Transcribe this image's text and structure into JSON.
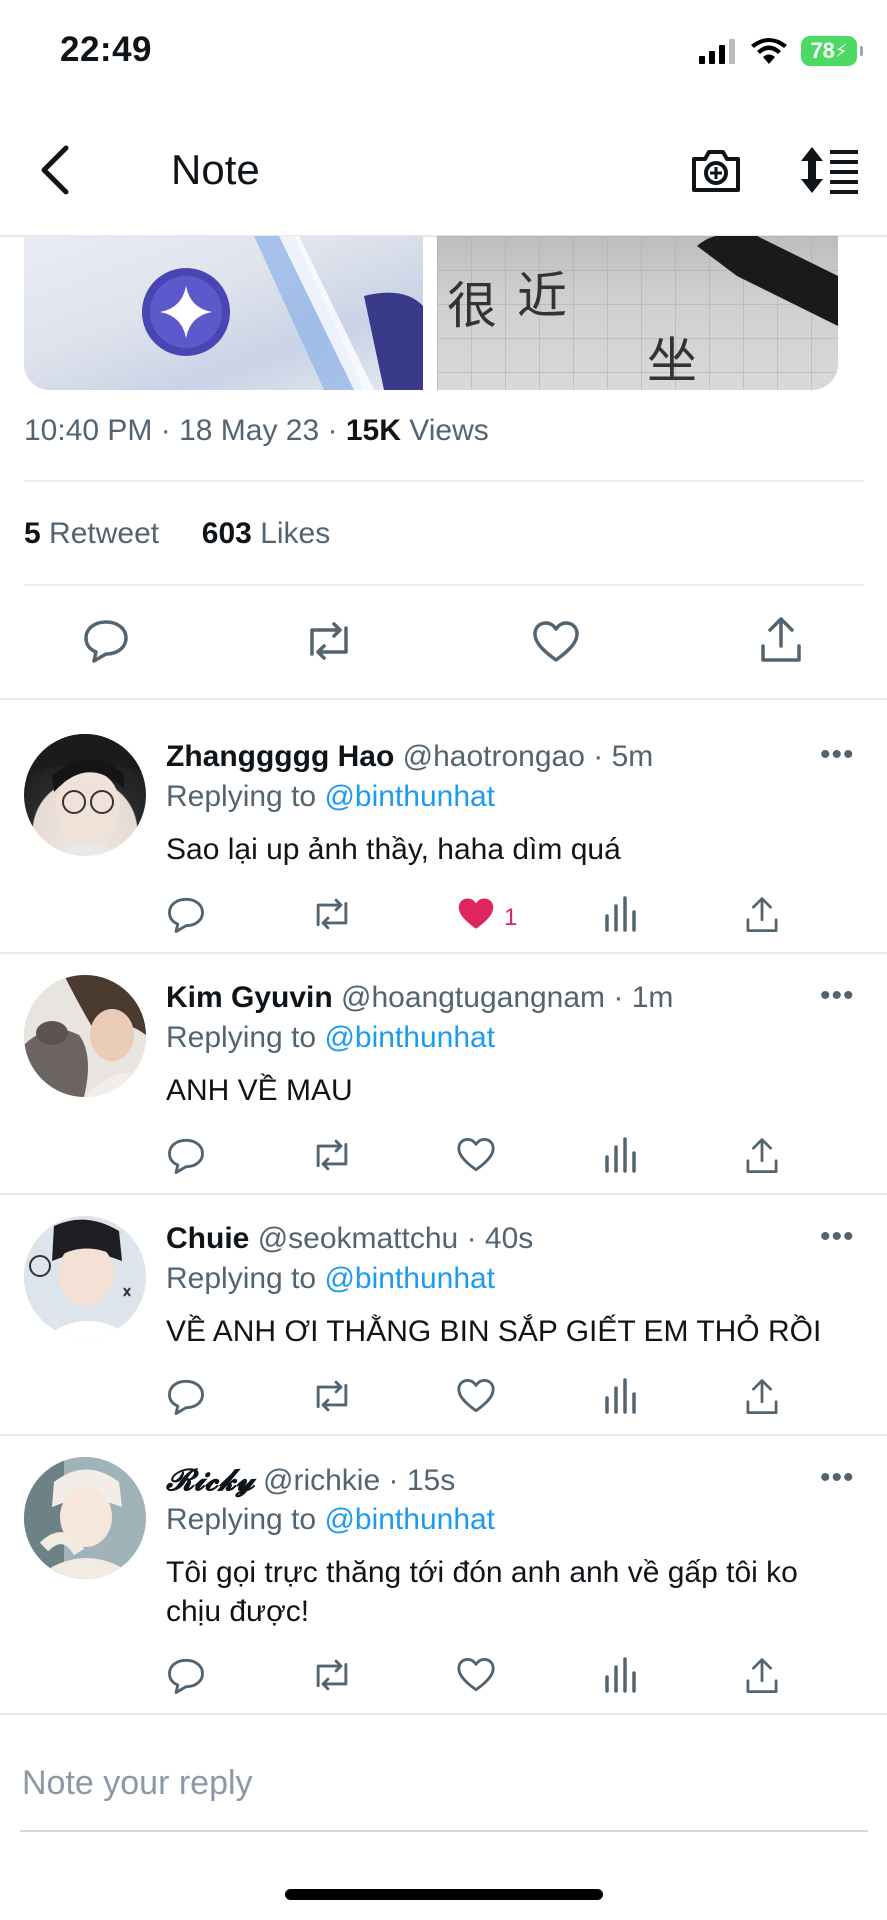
{
  "status_bar": {
    "time": "22:49",
    "battery": "78"
  },
  "nav": {
    "title": "Note",
    "back_icon": "chevron-left-icon",
    "camera_icon": "camera-plus-icon",
    "sort_icon": "sort-list-icon"
  },
  "tweet": {
    "time": "10:40 PM",
    "date": "18 May 23",
    "views_count": "15K",
    "views_label": "Views",
    "retweet_count": "5",
    "retweet_label": "Retweet",
    "likes_count": "603",
    "likes_label": "Likes"
  },
  "replies": [
    {
      "name": "Zhanggggg Hao",
      "handle": "@haotrongao",
      "time": "5m",
      "replying_label": "Replying to",
      "mention": "@binthunhat",
      "text": "Sao lại up ảnh thầy, haha dìm quá",
      "liked": true,
      "like_count": "1"
    },
    {
      "name": "Kim Gyuvin",
      "handle": "@hoangtugangnam",
      "time": "1m",
      "replying_label": "Replying to",
      "mention": "@binthunhat",
      "text": "ANH VỀ MAU",
      "liked": false,
      "like_count": ""
    },
    {
      "name": "Chuie",
      "handle": "@seokmattchu",
      "time": "40s",
      "replying_label": "Replying to",
      "mention": "@binthunhat",
      "text": "VỀ ANH ƠI THẰNG BIN SẮP GIẾT EM THỎ RỒI",
      "liked": false,
      "like_count": ""
    },
    {
      "name": "𝓡𝓲𝓬𝓴𝔂",
      "handle": "@richkie",
      "time": "15s",
      "replying_label": "Replying to",
      "mention": "@binthunhat",
      "text": "Tôi gọi trực thăng tới đón anh anh về gấp tôi ko chịu được!",
      "liked": false,
      "like_count": ""
    }
  ],
  "reply_box": {
    "placeholder": "Note your reply"
  },
  "colors": {
    "accent": "#1d9bf0",
    "like": "#e0245e",
    "muted": "#536471"
  },
  "media_text": {
    "right_chars": [
      "很",
      "近",
      "坐"
    ]
  }
}
